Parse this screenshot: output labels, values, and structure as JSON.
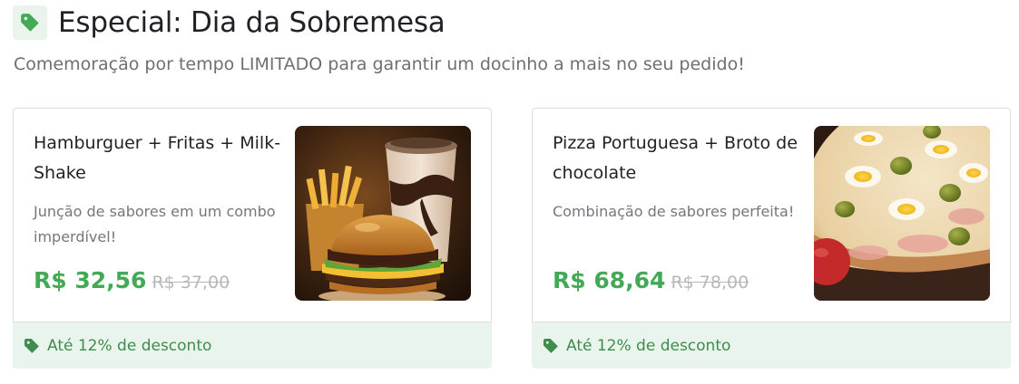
{
  "section": {
    "title": "Especial: Dia da Sobremesa",
    "subtitle": "Comemoração por tempo LIMITADO para garantir um docinho a mais no seu pedido!",
    "icon": "tag-icon",
    "accent_color": "#44a957"
  },
  "cards": [
    {
      "title": "Hamburguer + Fritas + Milk-Shake",
      "description": "Junção de sabores em um combo imperdível!",
      "price": "R$ 32,56",
      "old_price": "R$ 37,00",
      "discount": "Até 12% de desconto",
      "image": "burger-fries-milkshake-photo"
    },
    {
      "title": "Pizza Portuguesa + Broto de chocolate",
      "description": "Combinação de sabores perfeita!",
      "price": "R$ 68,64",
      "old_price": "R$ 78,00",
      "discount": "Até 12% de desconto",
      "image": "pizza-portuguesa-photo"
    }
  ]
}
